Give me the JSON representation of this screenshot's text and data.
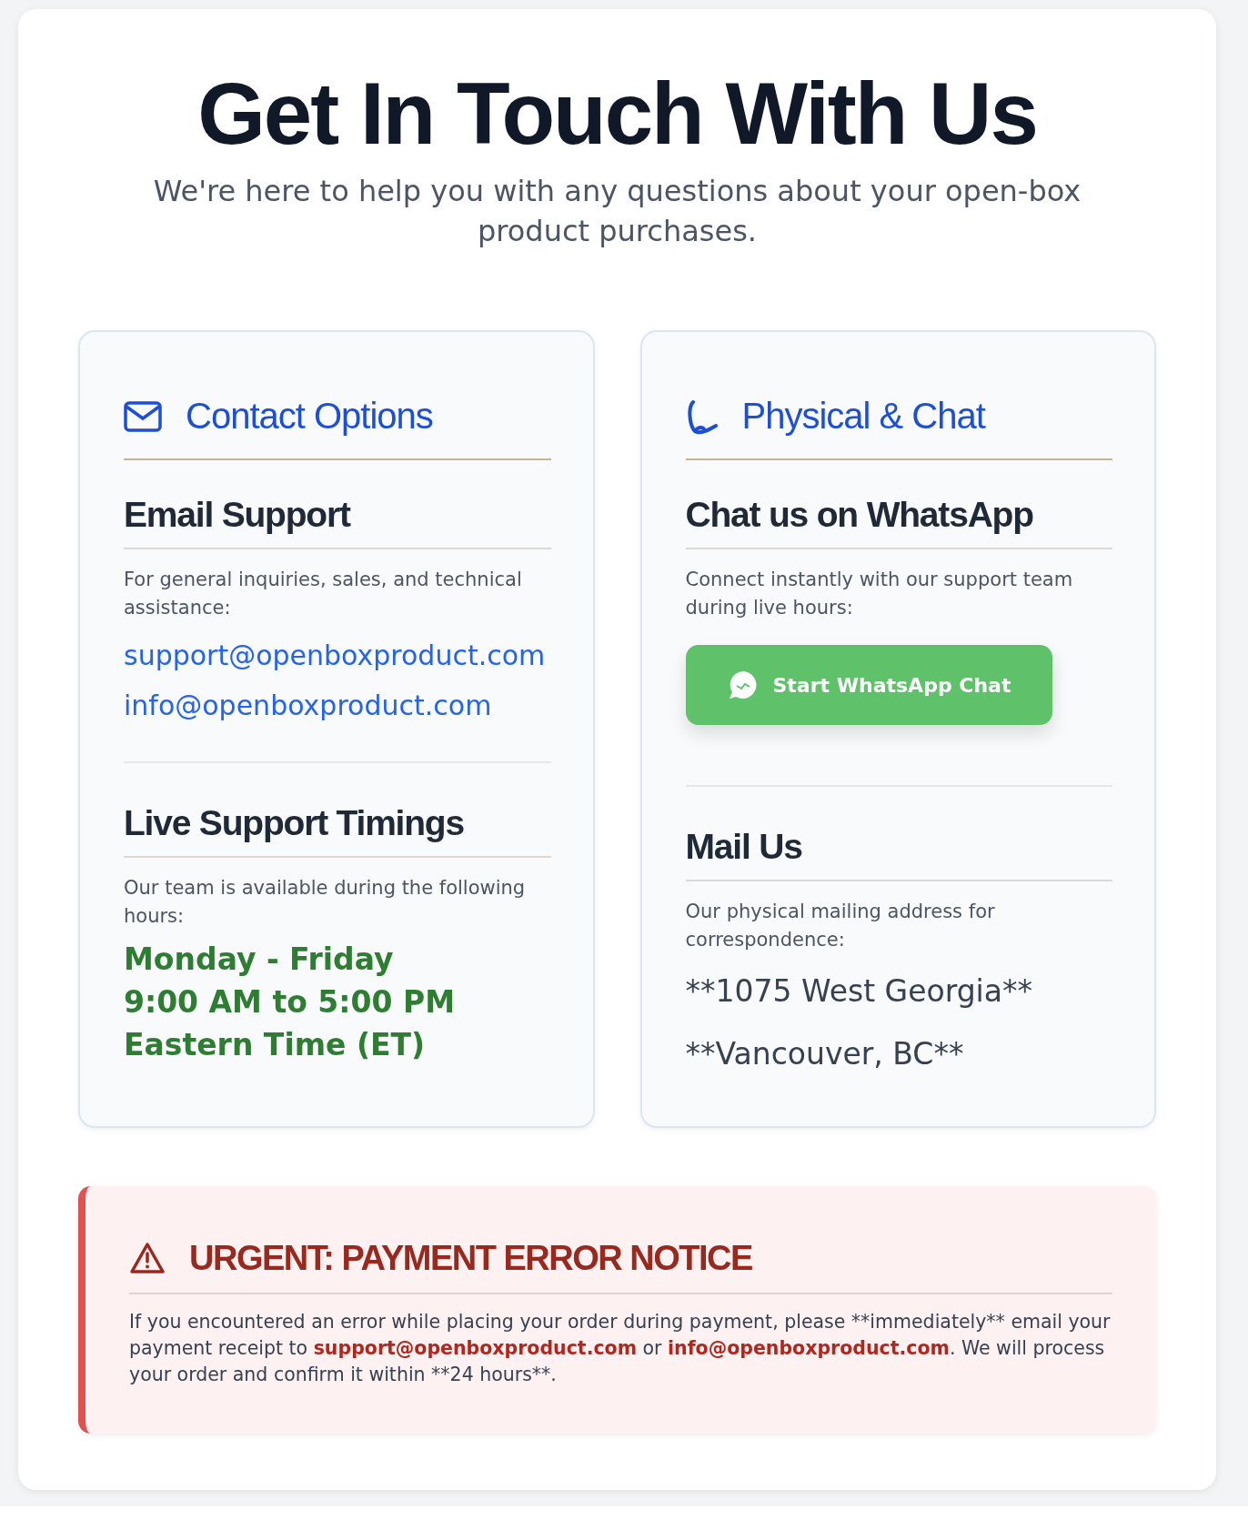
{
  "title": "Get In Touch With Us",
  "subtitle": "We're here to help you with any questions about your open-box product purchases.",
  "cards": [
    {
      "kind": "mail",
      "title": "Contact Options",
      "sections": [
        {
          "heading": "Email Support",
          "text": "For general inquiries, sales, and technical assistance:",
          "kind": "links",
          "lines": [
            "support@openboxproduct.com",
            "info@openboxproduct.com"
          ]
        },
        {
          "heading": "Live Support Timings",
          "text": "Our team is available during the following hours:",
          "kind": "hours",
          "lines": [
            "Monday - Friday",
            "9:00 AM to 5:00 PM",
            "Eastern Time (ET)"
          ]
        }
      ]
    },
    {
      "kind": "phone",
      "title": "Physical & Chat",
      "sections": [
        {
          "heading": "Chat us on WhatsApp",
          "text": "Connect instantly with our support team during live hours:",
          "kind": "button",
          "button": "Start WhatsApp Chat"
        },
        {
          "heading": "Mail Us",
          "text": "Our physical mailing address for correspondence:",
          "kind": "address",
          "lines": [
            "**1075 West Georgia**",
            "**Vancouver, BC**"
          ]
        }
      ]
    }
  ],
  "notice": {
    "title": "URGENT: PAYMENT ERROR NOTICE",
    "parts": [
      {
        "kind": "text",
        "text": "If you encountered an error while placing your order during payment, please **immediately** email your payment receipt to "
      },
      {
        "kind": "link",
        "text": "support@openboxproduct.com"
      },
      {
        "kind": "text",
        "text": " or "
      },
      {
        "kind": "link",
        "text": "info@openboxproduct.com"
      },
      {
        "kind": "text",
        "text": ". We will process your order and confirm it within **24 hours**."
      }
    ]
  }
}
